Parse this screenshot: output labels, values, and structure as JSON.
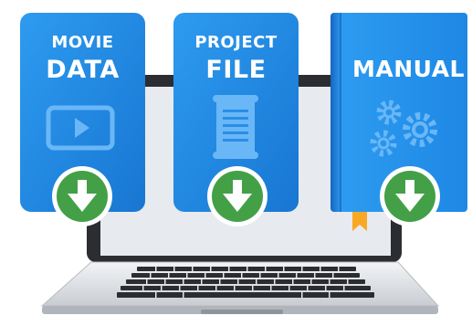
{
  "cards": [
    {
      "line1": "MOVIE",
      "line2": "DATA",
      "icon": "video-play-icon",
      "action_icon": "download-arrow-icon"
    },
    {
      "line1": "PROJECT",
      "line2": "FILE",
      "icon": "document-scroll-icon",
      "action_icon": "download-arrow-icon"
    },
    {
      "line1": "MANUAL",
      "icon": "gears-icon",
      "action_icon": "download-arrow-icon"
    }
  ],
  "colors": {
    "card_blue": "#1e88e5",
    "card_blue_dark": "#1565c0",
    "icon_blue": "#64b5f6",
    "download_green": "#43a047",
    "bookmark_orange": "#f9a825",
    "laptop_silver": "#e0e3e6",
    "laptop_dark": "#3a3d42"
  }
}
